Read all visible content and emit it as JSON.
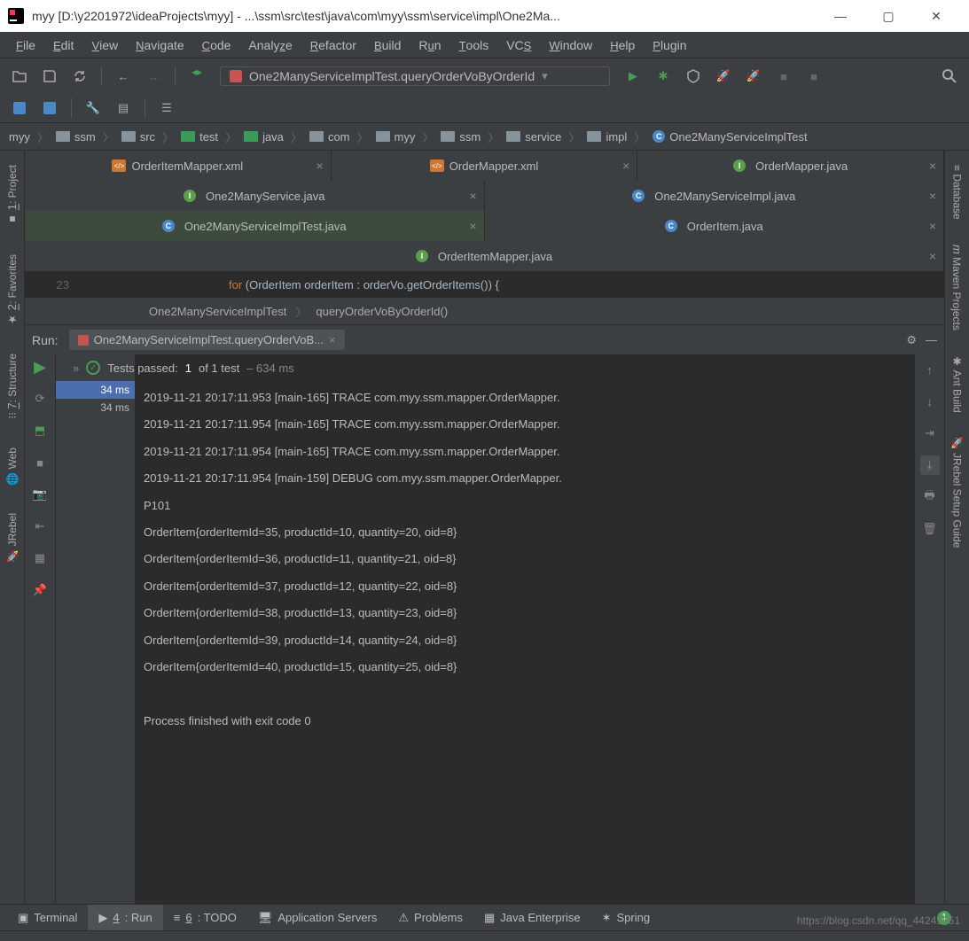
{
  "title": "myy [D:\\y2201972\\ideaProjects\\myy] - ...\\ssm\\src\\test\\java\\com\\myy\\ssm\\service\\impl\\One2Ma...",
  "menu": [
    "File",
    "Edit",
    "View",
    "Navigate",
    "Code",
    "Analyze",
    "Refactor",
    "Build",
    "Run",
    "Tools",
    "VCS",
    "Window",
    "Help",
    "Plugin"
  ],
  "runconfig": "One2ManyServiceImplTest.queryOrderVoByOrderId",
  "breadcrumb": [
    "myy",
    "ssm",
    "src",
    "test",
    "java",
    "com",
    "myy",
    "ssm",
    "service",
    "impl",
    "One2ManyServiceImplTest"
  ],
  "tabs_row1": [
    {
      "label": "OrderItemMapper.xml",
      "type": "xml"
    },
    {
      "label": "OrderMapper.xml",
      "type": "xml"
    },
    {
      "label": "OrderMapper.java",
      "type": "i"
    }
  ],
  "tabs_row2": [
    {
      "label": "One2ManyService.java",
      "type": "i"
    },
    {
      "label": "One2ManyServiceImpl.java",
      "type": "c"
    }
  ],
  "tabs_row3": [
    {
      "label": "One2ManyServiceImplTest.java",
      "type": "c",
      "active": true
    },
    {
      "label": "OrderItem.java",
      "type": "c"
    }
  ],
  "tabs_row4": [
    {
      "label": "OrderItemMapper.java",
      "type": "i"
    }
  ],
  "editor_lineno": "23",
  "editor_code_kw": "for",
  "editor_code_rest": " (OrderItem orderItem : orderVo.getOrderItems()) {",
  "editor_crumbs": [
    "One2ManyServiceImplTest",
    "queryOrderVoByOrderId()"
  ],
  "run": {
    "label": "Run:",
    "tab": "One2ManyServiceImplTest.queryOrderVoB...",
    "passed_prefix": "Tests passed:",
    "passed_n": "1",
    "passed_of": "of 1 test",
    "passed_time": "– 634 ms",
    "times": [
      "34 ms",
      "34 ms"
    ],
    "console": "2019-11-21 20:17:11.953 [main-165] TRACE com.myy.ssm.mapper.OrderMapper.\n2019-11-21 20:17:11.954 [main-165] TRACE com.myy.ssm.mapper.OrderMapper.\n2019-11-21 20:17:11.954 [main-165] TRACE com.myy.ssm.mapper.OrderMapper.\n2019-11-21 20:17:11.954 [main-159] DEBUG com.myy.ssm.mapper.OrderMapper.\nP101\nOrderItem{orderItemId=35, productId=10, quantity=20, oid=8}\nOrderItem{orderItemId=36, productId=11, quantity=21, oid=8}\nOrderItem{orderItemId=37, productId=12, quantity=22, oid=8}\nOrderItem{orderItemId=38, productId=13, quantity=23, oid=8}\nOrderItem{orderItemId=39, productId=14, quantity=24, oid=8}\nOrderItem{orderItemId=40, productId=15, quantity=25, oid=8}\n\nProcess finished with exit code 0"
  },
  "left_tools": [
    {
      "label": "1: Project"
    },
    {
      "label": "2: Favorites"
    },
    {
      "label": "7: Structure"
    },
    {
      "label": "Web"
    },
    {
      "label": "JRebel"
    }
  ],
  "right_tools": [
    {
      "label": "Database"
    },
    {
      "label": "Maven Projects"
    },
    {
      "label": "Ant Build"
    },
    {
      "label": "JRebel Setup Guide"
    }
  ],
  "bottom_tools": [
    "Terminal",
    "4: Run",
    "6: TODO",
    "Application Servers",
    "Problems",
    "Java Enterprise",
    "Spring"
  ],
  "watermark": "https://blog.csdn.net/qq_44241551"
}
